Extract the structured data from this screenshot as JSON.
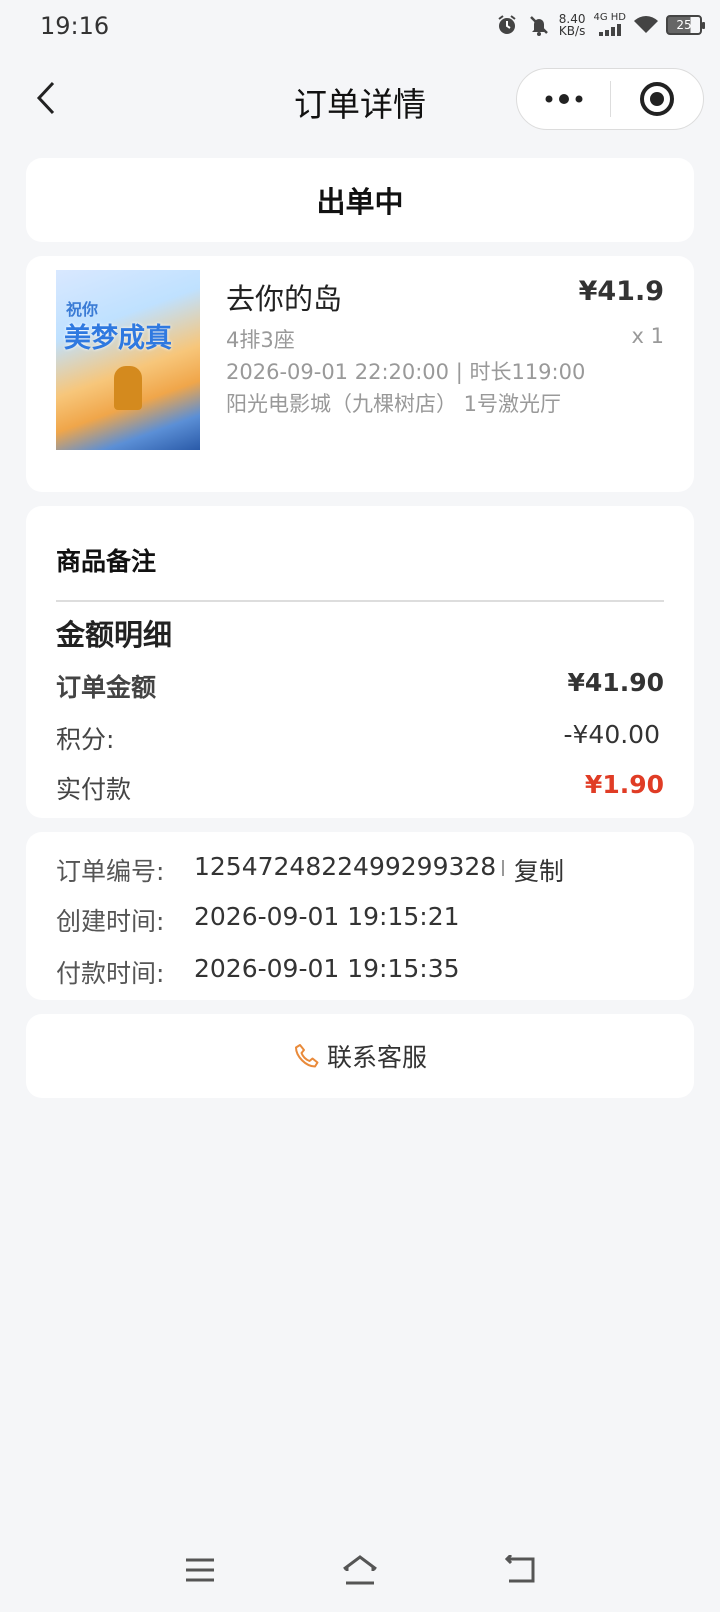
{
  "status_bar": {
    "time": "19:16",
    "net_speed_value": "8.40",
    "net_speed_unit": "KB/s",
    "network": "4G HD",
    "battery": "25",
    "icons": [
      "alarm-icon",
      "mute-icon",
      "signal-icon",
      "wifi-icon",
      "battery-icon"
    ]
  },
  "nav": {
    "title": "订单详情",
    "icons": [
      "back-icon",
      "more-icon",
      "close-icon"
    ]
  },
  "order_status": "出单中",
  "movie": {
    "poster_text_1": "祝你",
    "poster_text_2": "美梦成真",
    "title": "去你的岛",
    "price": "¥41.9",
    "seat": "4排3座",
    "quantity": "x 1",
    "showtime": "2026-09-01 22:20:00 | 时长119:00",
    "cinema": "阳光电影城（九棵树店） 1号激光厅"
  },
  "amount": {
    "remark_label": "商品备注",
    "title": "金额明细",
    "order_amount_label": "订单金额",
    "order_amount_value": "¥41.90",
    "points_label": "积分:",
    "points_value": "-¥40.00",
    "paid_label": "实付款",
    "paid_value": "¥1.90"
  },
  "info": {
    "order_no_label": "订单编号:",
    "order_no_value": "1254724822499299328",
    "copy_label": "复制",
    "created_label": "创建时间:",
    "created_value": "2026-09-01 19:15:21",
    "paid_time_label": "付款时间:",
    "paid_time_value": "2026-09-01 19:15:35"
  },
  "service": {
    "label": "联系客服",
    "icon": "phone-icon"
  },
  "colors": {
    "background": "#f5f6f8",
    "card": "#ffffff",
    "paid_red": "#e03c25",
    "phone_orange": "#e98a3a"
  }
}
